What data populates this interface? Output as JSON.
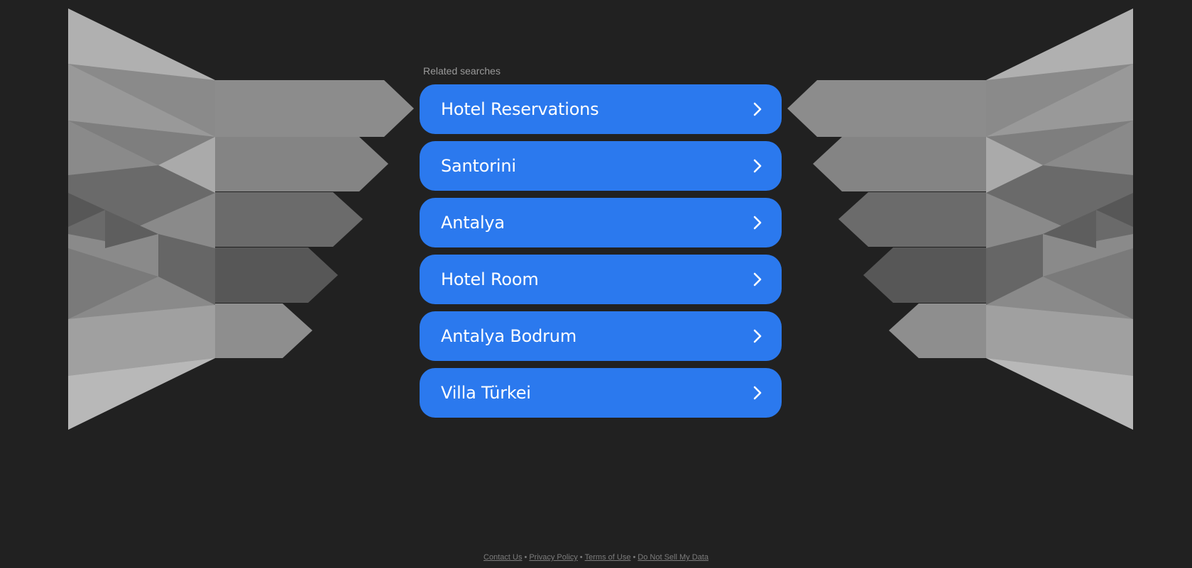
{
  "page": {
    "background": "#212121",
    "accent": "#2b79ee"
  },
  "related": {
    "label": "Related searches",
    "items": [
      {
        "label": "Hotel Reservations",
        "icon": "chevron-right-icon"
      },
      {
        "label": "Santorini",
        "icon": "chevron-right-icon"
      },
      {
        "label": "Antalya",
        "icon": "chevron-right-icon"
      },
      {
        "label": "Hotel Room",
        "icon": "chevron-right-icon"
      },
      {
        "label": "Antalya Bodrum",
        "icon": "chevron-right-icon"
      },
      {
        "label": "Villa Türkei",
        "icon": "chevron-right-icon"
      }
    ]
  },
  "footer": {
    "links": [
      "Contact Us",
      "Privacy Policy",
      "Terms of Use",
      "Do Not Sell My Data"
    ],
    "separator": "•"
  }
}
